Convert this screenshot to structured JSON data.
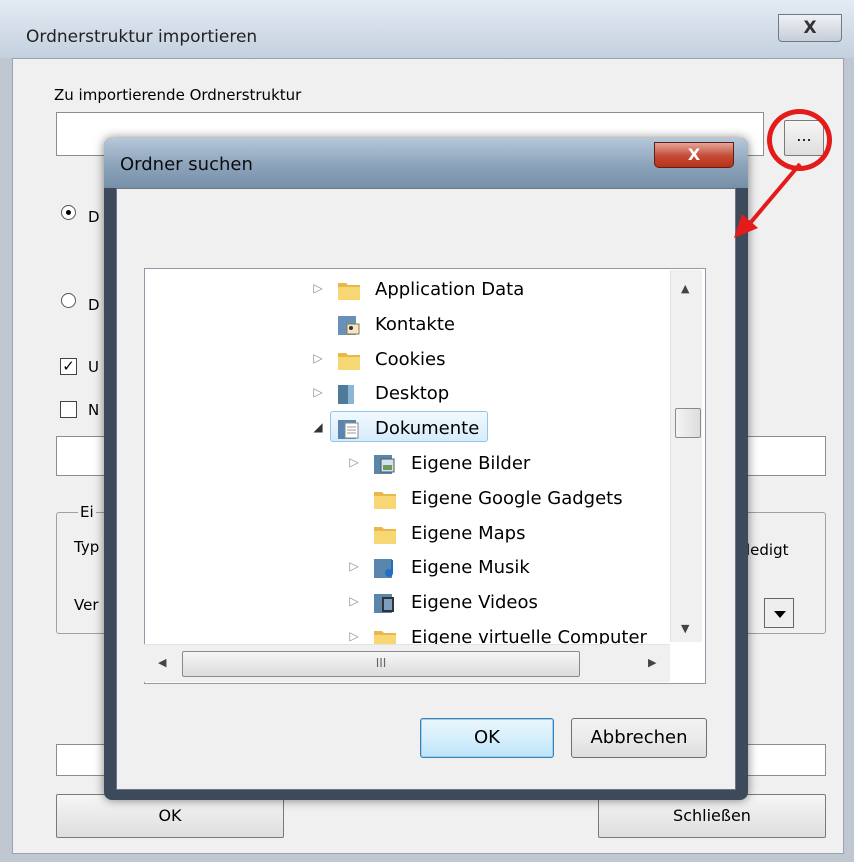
{
  "outer_dialog": {
    "title": "Ordnerstruktur importieren",
    "close_label": "X",
    "import_label": "Zu importierende Ordnerstruktur",
    "import_value": "",
    "browse_label": "...",
    "radio1_label": "D",
    "radio2_label": "D",
    "check1_label": "U",
    "check2_label": "N",
    "group_title": "Ei",
    "typ_label": "Typ",
    "ver_label": "Ver",
    "erledigt_label": "ledigt",
    "ok_label": "OK",
    "close_button_label": "Schließen"
  },
  "folder_dialog": {
    "title": "Ordner suchen",
    "close_label": "X",
    "ok_label": "OK",
    "cancel_label": "Abbrechen",
    "selected": "Dokumente",
    "tree": [
      {
        "name": "Application Data",
        "level": 0,
        "expander": "collapsed",
        "icon": "folder-icon"
      },
      {
        "name": "Kontakte",
        "level": 0,
        "expander": "none",
        "icon": "contacts-folder-icon"
      },
      {
        "name": "Cookies",
        "level": 0,
        "expander": "collapsed",
        "icon": "folder-icon"
      },
      {
        "name": "Desktop",
        "level": 0,
        "expander": "collapsed",
        "icon": "desktop-folder-icon"
      },
      {
        "name": "Dokumente",
        "level": 0,
        "expander": "expanded",
        "icon": "documents-folder-icon"
      },
      {
        "name": "Eigene Bilder",
        "level": 1,
        "expander": "collapsed",
        "icon": "pictures-folder-icon"
      },
      {
        "name": "Eigene Google Gadgets",
        "level": 1,
        "expander": "none",
        "icon": "folder-icon"
      },
      {
        "name": "Eigene Maps",
        "level": 1,
        "expander": "none",
        "icon": "folder-icon"
      },
      {
        "name": "Eigene Musik",
        "level": 1,
        "expander": "collapsed",
        "icon": "music-folder-icon"
      },
      {
        "name": "Eigene Videos",
        "level": 1,
        "expander": "collapsed",
        "icon": "videos-folder-icon"
      },
      {
        "name": "Eigene virtuelle Computer",
        "level": 1,
        "expander": "collapsed",
        "icon": "folder-icon"
      }
    ],
    "hscroll_grip": "III"
  },
  "colors": {
    "annotation_red": "#e31b1b",
    "selection_border": "#8fc6ed"
  }
}
